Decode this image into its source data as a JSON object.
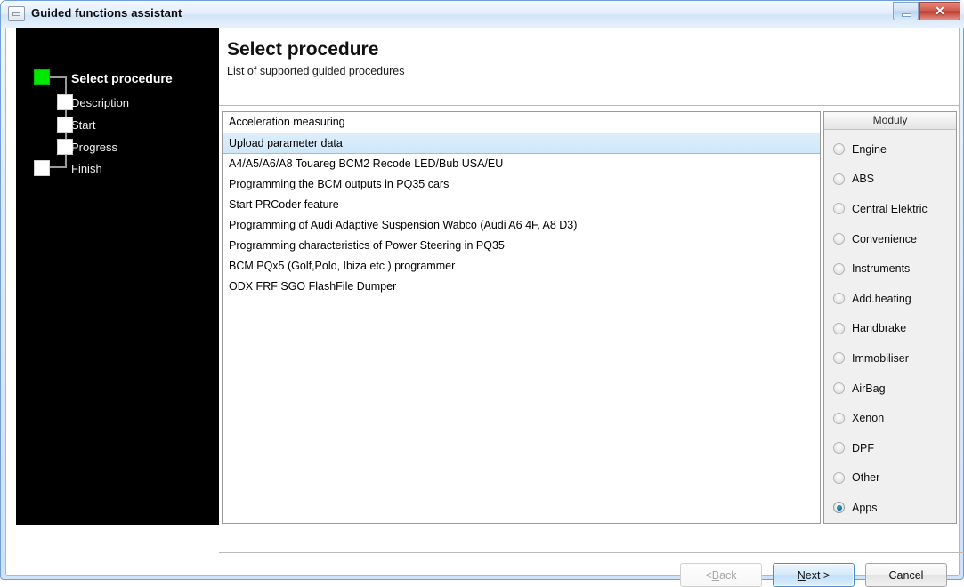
{
  "window": {
    "title": "Guided functions assistant",
    "icon": "window-box-icon",
    "controls": {
      "minimize_label": "",
      "close_label": "✕"
    }
  },
  "sidebar": {
    "steps": [
      {
        "label": "Select procedure",
        "state": "active"
      },
      {
        "label": "Description",
        "state": "pending"
      },
      {
        "label": "Start",
        "state": "pending"
      },
      {
        "label": "Progress",
        "state": "pending"
      },
      {
        "label": "Finish",
        "state": "pending"
      }
    ],
    "active_color": "#00e700",
    "background": "#000000"
  },
  "main": {
    "title": "Select procedure",
    "subtitle": "List of supported guided procedures",
    "procedures": [
      {
        "label": "Acceleration measuring",
        "selected": false
      },
      {
        "label": "Upload parameter data",
        "selected": true
      },
      {
        "label": "A4/A5/A6/A8 Touareg BCM2 Recode LED/Bub USA/EU",
        "selected": false
      },
      {
        "label": "Programming the BCM outputs in PQ35 cars",
        "selected": false
      },
      {
        "label": "Start PRCoder feature",
        "selected": false
      },
      {
        "label": "Programming of Audi Adaptive Suspension Wabco (Audi A6 4F, A8 D3)",
        "selected": false
      },
      {
        "label": "Programming characteristics of Power Steering in PQ35",
        "selected": false
      },
      {
        "label": "BCM PQx5 (Golf,Polo, Ibiza etc ) programmer",
        "selected": false
      },
      {
        "label": "ODX FRF SGO FlashFile Dumper",
        "selected": false
      }
    ],
    "selection_color": "#cfe7fa"
  },
  "moduly": {
    "header": "Moduly",
    "options": [
      {
        "label": "Engine",
        "checked": false
      },
      {
        "label": "ABS",
        "checked": false
      },
      {
        "label": "Central Elektric",
        "checked": false
      },
      {
        "label": "Convenience",
        "checked": false
      },
      {
        "label": "Instruments",
        "checked": false
      },
      {
        "label": "Add.heating",
        "checked": false
      },
      {
        "label": "Handbrake",
        "checked": false
      },
      {
        "label": "Immobiliser",
        "checked": false
      },
      {
        "label": "AirBag",
        "checked": false
      },
      {
        "label": "Xenon",
        "checked": false
      },
      {
        "label": "DPF",
        "checked": false
      },
      {
        "label": "Other",
        "checked": false
      },
      {
        "label": "Apps",
        "checked": true
      }
    ],
    "checked_color": "#0a6e92"
  },
  "footer": {
    "back": {
      "prefix": "< ",
      "mnemonic": "B",
      "suffix": "ack",
      "disabled": true
    },
    "next": {
      "prefix": "",
      "mnemonic": "N",
      "suffix": "ext >",
      "default": true
    },
    "cancel": {
      "label": "Cancel"
    }
  }
}
